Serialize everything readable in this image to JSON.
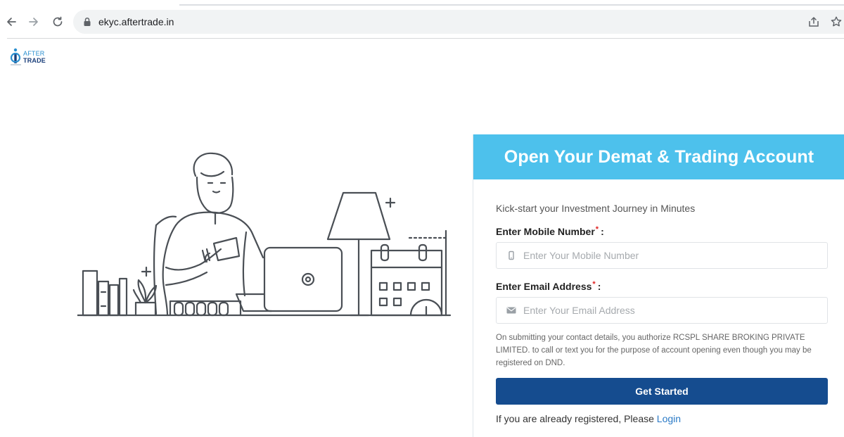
{
  "browser": {
    "url": "ekyc.aftertrade.in"
  },
  "logo": {
    "line1": "AFTER",
    "line2": "TRADE"
  },
  "form": {
    "title": "Open Your Demat & Trading Account",
    "subtitle": "Kick-start your Investment Journey in Minutes",
    "mobile_label": "Enter Mobile Number",
    "mobile_placeholder": "Enter Your Mobile Number",
    "email_label": "Enter Email Address",
    "email_placeholder": "Enter Your Email Address",
    "required_mark": "*",
    "colon": ":",
    "consent_text": "On submitting your contact details, you authorize RCSPL SHARE BROKING PRIVATE LIMITED. to call or text you for the purpose of account opening even though you may be registered on DND.",
    "submit_label": "Get Started",
    "login_prompt": "If you are already registered, Please",
    "login_link": "Login"
  },
  "colors": {
    "header_bg": "#4dc1ec",
    "button_bg": "#154c8f",
    "link": "#2a7ac6"
  }
}
